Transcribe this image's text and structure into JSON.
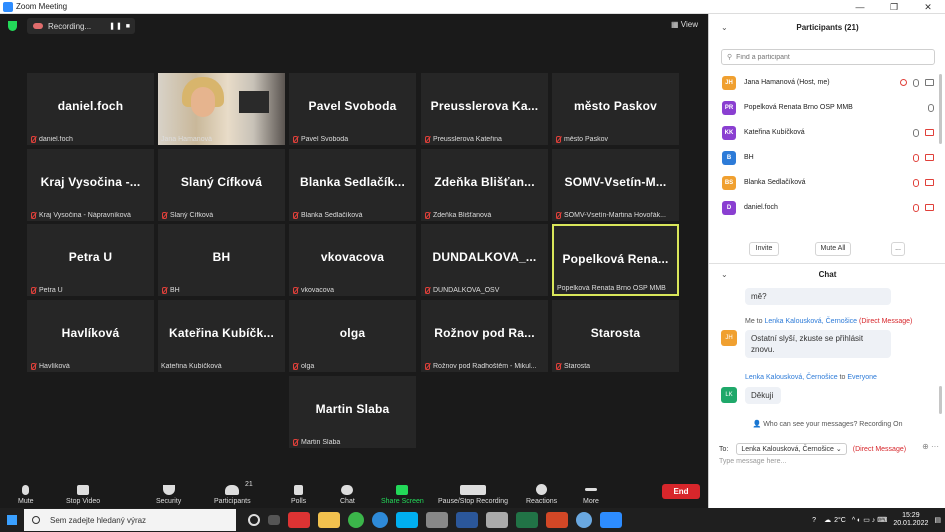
{
  "window": {
    "title": "Zoom Meeting",
    "controls": [
      "—",
      "❐",
      "✕"
    ]
  },
  "topbar": {
    "recording_label": "Recording...",
    "view_label": "View"
  },
  "tiles": [
    {
      "big": "daniel.foch",
      "small": "daniel.foch"
    },
    {
      "big": "",
      "small": "Jana Hamanová"
    },
    {
      "big": "Pavel Svoboda",
      "small": "Pavel Svoboda"
    },
    {
      "big": "Preusslerova Ka...",
      "small": "Preusslerova Kateřina"
    },
    {
      "big": "město Paskov",
      "small": "město Paskov"
    },
    {
      "big": "Kraj Vysočina -...",
      "small": "Kraj Vysočina - Nápravníková"
    },
    {
      "big": "Slaný Cífková",
      "small": "Slaný Cífková"
    },
    {
      "big": "Blanka Sedlačík...",
      "small": "Blanka Sedlačíková"
    },
    {
      "big": "Zdeňka Blišťan...",
      "small": "Zdeňka Blišťanová"
    },
    {
      "big": "SOMV-Vsetín-M...",
      "small": "SOMV-Vsetín-Martina Hovořák..."
    },
    {
      "big": "Petra U",
      "small": "Petra U"
    },
    {
      "big": "BH",
      "small": "BH"
    },
    {
      "big": "vkovacova",
      "small": "vkovacova"
    },
    {
      "big": "DUNDALKOVA_...",
      "small": "DUNDALKOVA_OSV"
    },
    {
      "big": "Popelková Rena...",
      "small": "Popelková Renata Brno OSP MMB"
    },
    {
      "big": "Havlíková",
      "small": "Havlíková"
    },
    {
      "big": "Kateřina Kubíčk...",
      "small": "Kateřina Kubíčková"
    },
    {
      "big": "olga",
      "small": "olga"
    },
    {
      "big": "Rožnov pod Ra...",
      "small": "Rožnov pod Radhoštěm - Mikul..."
    },
    {
      "big": "Starosta",
      "small": "Starosta"
    },
    {
      "big": "Martin Slaba",
      "small": "Martin Slaba"
    }
  ],
  "toolbar": {
    "mute": "Mute",
    "stop_video": "Stop Video",
    "security": "Security",
    "participants": "Participants",
    "participants_count": "21",
    "polls": "Polls",
    "chat": "Chat",
    "share_screen": "Share Screen",
    "pause_recording": "Pause/Stop Recording",
    "reactions": "Reactions",
    "more": "More",
    "end": "End"
  },
  "participants_panel": {
    "title": "Participants (21)",
    "find_placeholder": "Find a participant",
    "items": [
      {
        "initials": "JH",
        "name": "Jana Hamanová (Host, me)",
        "color": "#f0a030"
      },
      {
        "initials": "PR",
        "name": "Popelková Renata Brno OSP MMB",
        "color": "#8a3fd1"
      },
      {
        "initials": "KK",
        "name": "Kateřina Kubíčková",
        "color": "#8a3fd1"
      },
      {
        "initials": "B",
        "name": "BH",
        "color": "#2d7bd8"
      },
      {
        "initials": "BS",
        "name": "Blanka Sedlačíková",
        "color": "#f0a030"
      },
      {
        "initials": "D",
        "name": "daniel.foch",
        "color": "#8a3fd1"
      }
    ],
    "invite": "Invite",
    "mute_all": "Mute All",
    "more": "..."
  },
  "chat": {
    "title": "Chat",
    "prev_bubble": "mě?",
    "msg1_from": "Me to",
    "msg1_to": "Lenka Kalousková, Černošice",
    "msg1_dm": "(Direct Message)",
    "msg1_initials": "JH",
    "msg1_line1": "Ostatní slyší, zkuste se přihlásit",
    "msg1_line2": "znovu.",
    "msg2_from": "Lenka Kalousková, Černošice",
    "msg2_to_word": "to",
    "msg2_to": "Everyone",
    "msg2_initials": "LK",
    "msg2_text": "Děkuji",
    "who_can_see": "Who can see your messages? Recording On",
    "to_label": "To:",
    "to_value": "Lenka Kalousková, Černošice",
    "to_dm": "(Direct Message)",
    "type_placeholder": "Type message here..."
  },
  "taskbar": {
    "search_placeholder": "Sem zadejte hledaný výraz",
    "temperature": "2°C",
    "time": "15:29",
    "date": "20.01.2022"
  }
}
